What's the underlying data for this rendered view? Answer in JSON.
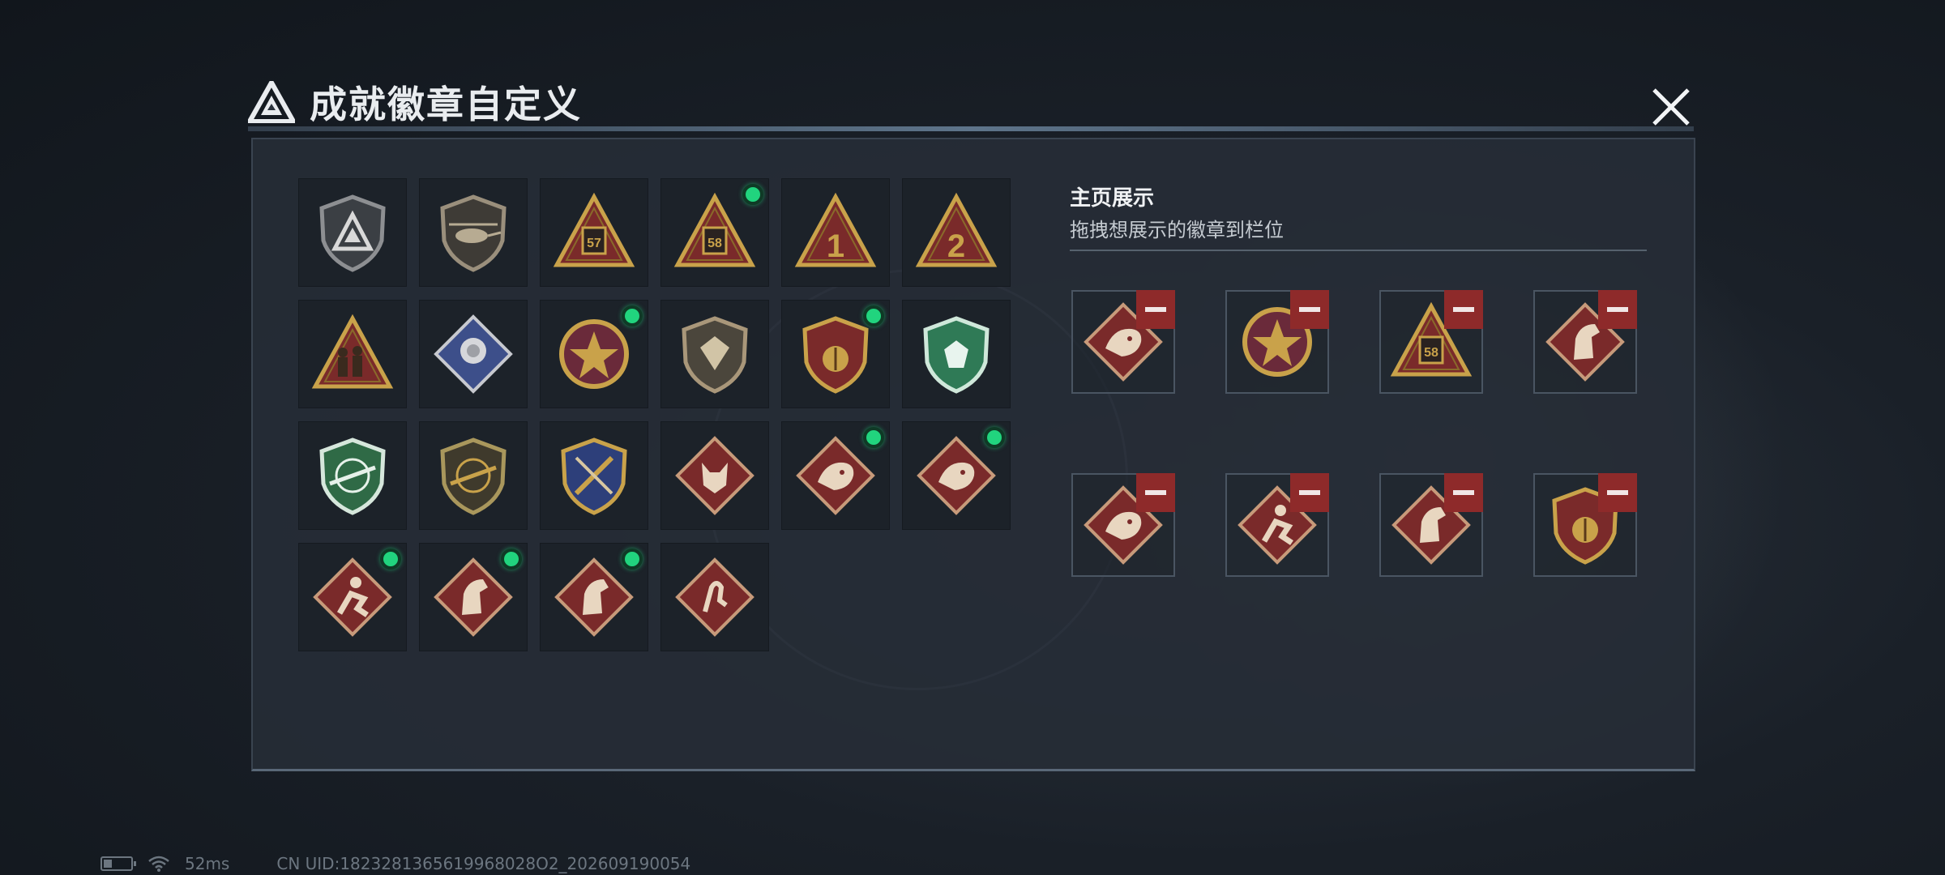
{
  "header": {
    "title": "成就徽章自定义",
    "close_icon": "close-icon"
  },
  "showcase": {
    "title": "主页展示",
    "subtitle": "拖拽想展示的徽章到栏位",
    "slots": [
      {
        "badge": "dragon-badge-red"
      },
      {
        "badge": "star-medal-badge"
      },
      {
        "badge": "triangle-58-badge"
      },
      {
        "badge": "horse-badge-red"
      },
      {
        "badge": "dragon-badge-red"
      },
      {
        "badge": "runner-badge-red"
      },
      {
        "badge": "horse-badge-red"
      },
      {
        "badge": "laurel-crest-badge"
      }
    ]
  },
  "badges": [
    {
      "icon": "shield-triangle-badge",
      "new": false
    },
    {
      "icon": "helicopter-shield-badge",
      "new": false
    },
    {
      "icon": "triangle-57-badge",
      "label": "57",
      "new": false
    },
    {
      "icon": "triangle-58-badge",
      "label": "58",
      "new": true
    },
    {
      "icon": "triangle-number-1-badge",
      "label": "1",
      "new": false
    },
    {
      "icon": "triangle-number-2-badge",
      "label": "2",
      "new": false
    },
    {
      "icon": "soldiers-triangle-badge",
      "new": false
    },
    {
      "icon": "rose-diamond-badge",
      "new": false
    },
    {
      "icon": "star-medal-badge",
      "new": true
    },
    {
      "icon": "gold-shield-badge",
      "new": false
    },
    {
      "icon": "laurel-crest-badge",
      "new": true
    },
    {
      "icon": "green-gem-badge",
      "new": false
    },
    {
      "icon": "green-rifle-badge",
      "new": false
    },
    {
      "icon": "gold-rifle-badge",
      "new": false
    },
    {
      "icon": "blue-sword-badge",
      "new": false
    },
    {
      "icon": "wolf-badge-red",
      "new": false
    },
    {
      "icon": "dragon-badge-red",
      "new": true
    },
    {
      "icon": "dragon-badge-red",
      "new": true
    },
    {
      "icon": "runner-badge-red",
      "new": true
    },
    {
      "icon": "horse-badge-red",
      "new": true
    },
    {
      "icon": "horse-badge-red",
      "new": true
    },
    {
      "icon": "hand-badge-red",
      "new": false
    }
  ],
  "status_bar": {
    "latency": "52ms",
    "uid": "CN UID:1823281365619968028O2_202609190054",
    "battery_icon": "battery-icon",
    "wifi_icon": "wifi-icon"
  },
  "colors": {
    "new_dot": "#21d47e",
    "remove_button": "#8e2a2a",
    "gold": "#c9a24a",
    "red_badge": "#7a2a2a"
  }
}
